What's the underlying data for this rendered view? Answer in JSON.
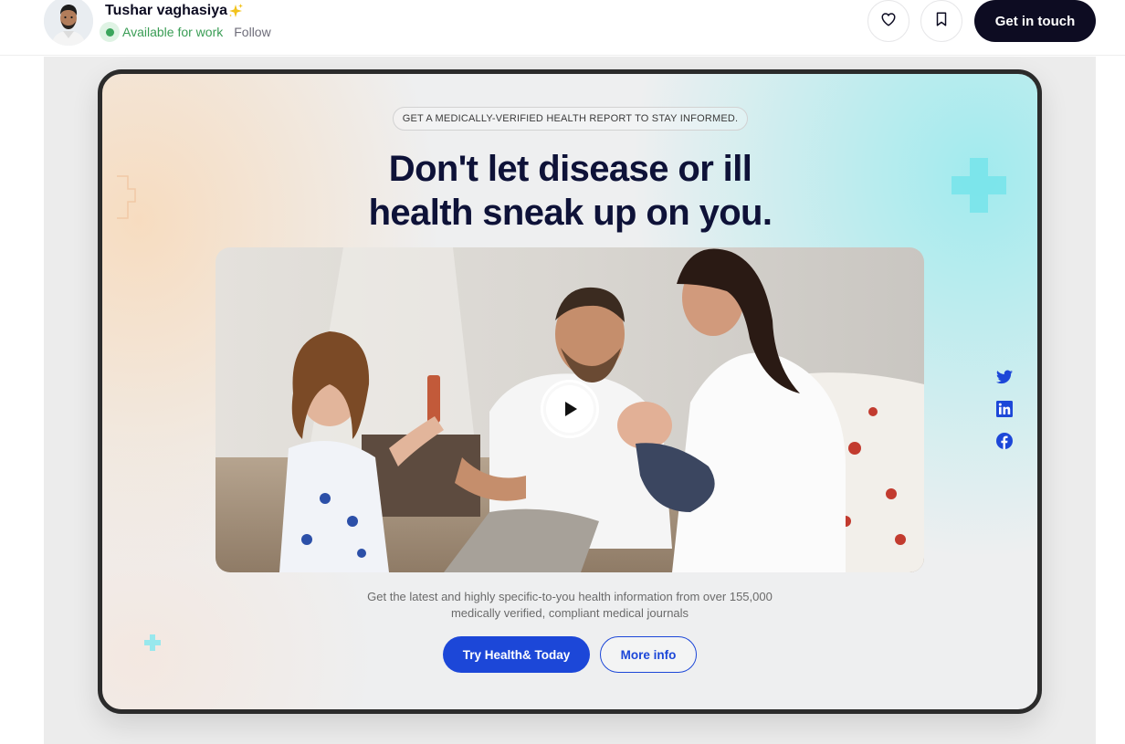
{
  "header": {
    "author_name": "Tushar vaghasiya",
    "status": "Available for work",
    "follow_label": "Follow",
    "cta_label": "Get in touch",
    "icons": [
      "heart-icon",
      "bookmark-icon",
      "sparkle-icon"
    ]
  },
  "hero": {
    "eyebrow": "GET A MEDICALLY-VERIFIED HEALTH REPORT TO STAY INFORMED.",
    "headline_line1": "Don't let disease or ill",
    "headline_line2": "health sneak up on you.",
    "description_line1": "Get the latest and highly specific-to-you health information from over 155,000",
    "description_line2": "medically verified, compliant medical journals",
    "primary_button": "Try Health& Today",
    "secondary_button": "More info"
  },
  "social": [
    "twitter-icon",
    "linkedin-icon",
    "facebook-icon"
  ],
  "colors": {
    "brand_blue": "#1c47d8",
    "headline_navy": "#0e1238",
    "status_green": "#3ba55c",
    "accent_cyan": "#7fe6ea"
  }
}
